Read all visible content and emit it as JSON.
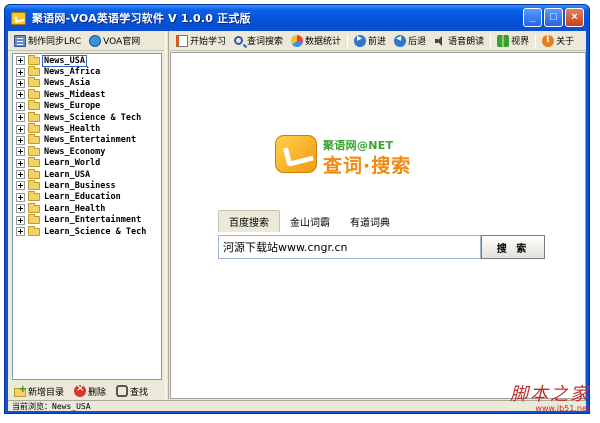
{
  "window": {
    "title": "聚语网-VOA英语学习软件  V 1.0.0 正式版",
    "controls": {
      "minimize": "_",
      "maximize": "□",
      "close": "×"
    }
  },
  "left_toolbar": [
    {
      "label": "制作同步LRC",
      "icon": "lrc-icon"
    },
    {
      "label": "VOA官网",
      "icon": "voa-icon"
    }
  ],
  "tree": {
    "items": [
      {
        "label": "News_USA",
        "selected": true
      },
      {
        "label": "News_Africa"
      },
      {
        "label": "News_Asia"
      },
      {
        "label": "News_Mideast"
      },
      {
        "label": "News_Europe"
      },
      {
        "label": "News_Science & Tech"
      },
      {
        "label": "News_Health"
      },
      {
        "label": "News_Entertainment"
      },
      {
        "label": "News_Economy"
      },
      {
        "label": "Learn_World"
      },
      {
        "label": "Learn_USA"
      },
      {
        "label": "Learn_Business"
      },
      {
        "label": "Learn_Education"
      },
      {
        "label": "Learn_Health"
      },
      {
        "label": "Learn_Entertainment"
      },
      {
        "label": "Learn_Science & Tech"
      }
    ]
  },
  "left_bottom": [
    {
      "label": "新增目录",
      "icon": "new-folder-icon"
    },
    {
      "label": "删除",
      "icon": "delete-icon"
    },
    {
      "label": "查找",
      "icon": "find-icon"
    }
  ],
  "main_toolbar": [
    {
      "label": "开始学习",
      "icon": "book-icon"
    },
    {
      "label": "查词搜索",
      "icon": "search-icon"
    },
    {
      "label": "数据统计",
      "icon": "stats-icon"
    },
    {
      "label": "前进",
      "icon": "forward-icon"
    },
    {
      "label": "后退",
      "icon": "back-icon"
    },
    {
      "label": "语音朗读",
      "icon": "speaker-icon"
    },
    {
      "label": "视界",
      "icon": "view-icon"
    },
    {
      "label": "关于",
      "icon": "about-icon"
    }
  ],
  "logo": {
    "top": "聚语网@NET",
    "main": "查词·搜索"
  },
  "search": {
    "tabs": [
      "百度搜索",
      "金山词霸",
      "有道词典"
    ],
    "active_tab": 0,
    "input_value": "河源下载站www.cngr.cn",
    "button_label": "搜 索"
  },
  "status": {
    "text": "当前浏览：News_USA"
  },
  "watermark": {
    "main": "脚本之家",
    "sub": "www.jb51.net"
  },
  "colors": {
    "titlebar": "#0553d8",
    "client_bg": "#ece9d8",
    "logo_orange": "#ef8a12",
    "logo_green": "#3aa22f",
    "watermark_red": "#c42a2a"
  }
}
